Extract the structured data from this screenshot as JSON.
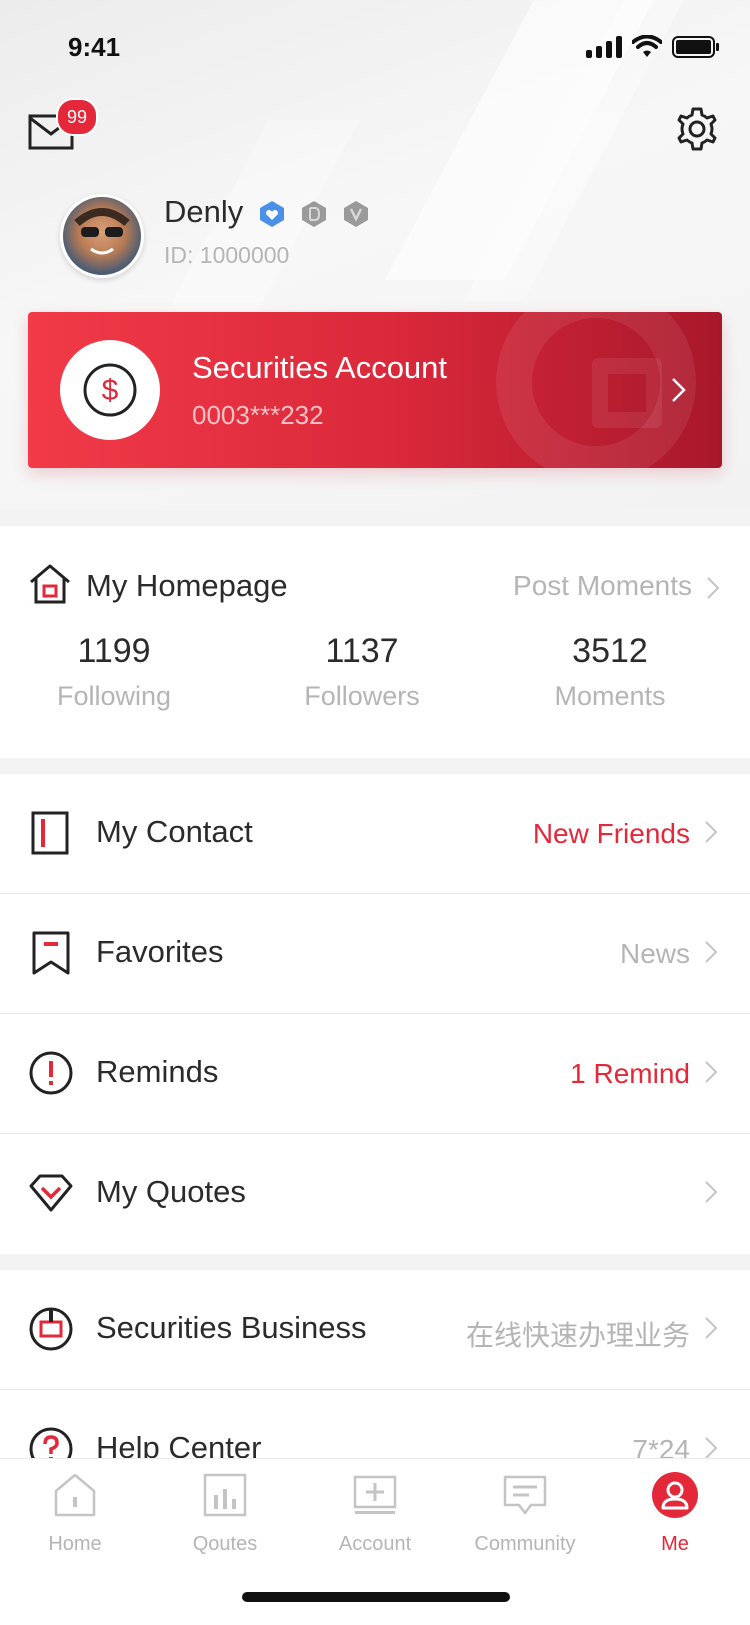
{
  "status_bar": {
    "time": "9:41"
  },
  "header": {
    "mail_badge": "99",
    "user": {
      "name": "Denly",
      "id_text": "ID: 1000000"
    },
    "level_icons": [
      "verified-badge-icon",
      "badge-d-icon",
      "badge-v-icon"
    ]
  },
  "account_card": {
    "title": "Securities Account",
    "number": "0003***232"
  },
  "homepage": {
    "title": "My Homepage",
    "link": "Post Moments",
    "stats": [
      {
        "value": "1199",
        "label": "Following"
      },
      {
        "value": "1137",
        "label": "Followers"
      },
      {
        "value": "3512",
        "label": "Moments"
      }
    ]
  },
  "menu": [
    {
      "label": "My Contact",
      "right": "New Friends"
    },
    {
      "label": "Favorites",
      "right": "News"
    },
    {
      "label": "Reminds",
      "right": "1 Remind"
    },
    {
      "label": "My Quotes",
      "right": ""
    },
    {
      "label": "Securities Business",
      "right": "在线快速办理业务"
    },
    {
      "label": "Help Center",
      "right": "7*24"
    }
  ],
  "tabbar": [
    {
      "label": "Home"
    },
    {
      "label": "Qoutes"
    },
    {
      "label": "Account"
    },
    {
      "label": "Community"
    },
    {
      "label": "Me"
    }
  ],
  "colors": {
    "accent": "#e4283a",
    "muted": "#b5b5b5",
    "text": "#2b2b2b"
  }
}
